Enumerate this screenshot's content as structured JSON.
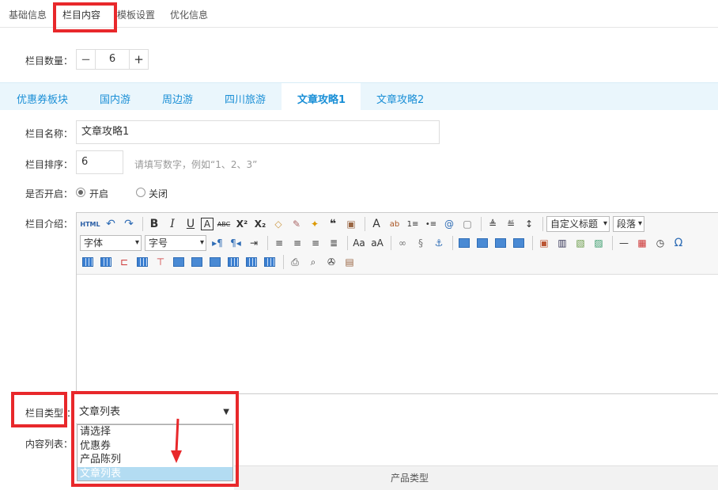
{
  "top_tabs": [
    "基础信息",
    "栏目内容",
    "模板设置",
    "优化信息"
  ],
  "quantity": {
    "label": "栏目数量：",
    "value": "6",
    "minus": "−",
    "plus": "+"
  },
  "column_tabs": [
    "优惠券板块",
    "国内游",
    "周边游",
    "四川旅游",
    "文章攻略1",
    "文章攻略2"
  ],
  "form": {
    "name_label": "栏目名称：",
    "name_value": "文章攻略1",
    "order_label": "栏目排序：",
    "order_value": "6",
    "order_hint": "请填写数字，例如“1、2、3”",
    "enable_label": "是否开启：",
    "enable_on": "开启",
    "enable_off": "关闭",
    "intro_label": "栏目介绍：",
    "type_label": "栏目类型",
    "type_colon": "：",
    "list_label": "内容列表："
  },
  "editor": {
    "html_btn": "HTML",
    "font_select": "字体",
    "size_select": "字号",
    "heading_select": "自定义标题",
    "para_select": "段落"
  },
  "type_select": {
    "selected": "文章列表",
    "options": [
      "请选择",
      "优惠券",
      "产品陈列",
      "文章列表"
    ]
  },
  "table": {
    "header": "产品类型"
  },
  "colors": {
    "accent": "#1a8fd6",
    "highlight": "#e8282b"
  }
}
